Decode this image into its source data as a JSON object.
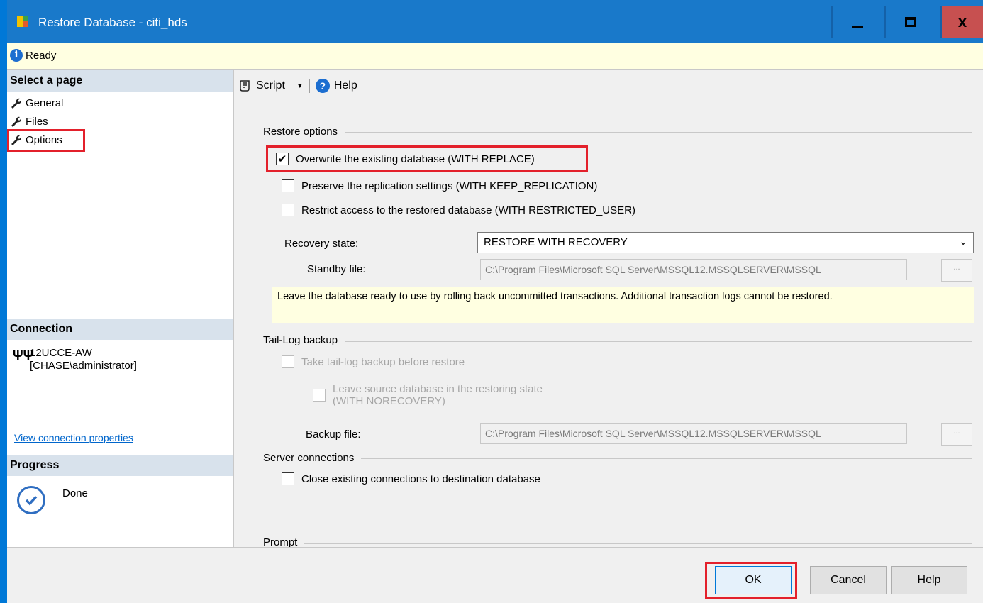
{
  "window": {
    "title": "Restore Database - citi_hds",
    "minimize_label": "minimize",
    "maximize_label": "maximize",
    "close_glyph": "x"
  },
  "status": {
    "text": "Ready",
    "icon": "info-icon"
  },
  "left": {
    "select_page_header": "Select a page",
    "pages": [
      {
        "label": "General",
        "icon": "wrench-icon"
      },
      {
        "label": "Files",
        "icon": "wrench-icon"
      },
      {
        "label": "Options",
        "icon": "wrench-icon",
        "highlighted": true
      }
    ],
    "connection_header": "Connection",
    "connection_server": "12UCCE-AW",
    "connection_user": "[CHASE\\administrator]",
    "view_connection_link": "View connection properties",
    "progress_header": "Progress",
    "progress_status": "Done"
  },
  "toolbar": {
    "script_label": "Script",
    "help_label": "Help"
  },
  "restore_options": {
    "group_label": "Restore options",
    "overwrite": {
      "label": "Overwrite the existing database (WITH REPLACE)",
      "checked": true
    },
    "preserve_replication": {
      "label": "Preserve the replication settings (WITH KEEP_REPLICATION)",
      "checked": false
    },
    "restrict_access": {
      "label": "Restrict access to the restored database (WITH RESTRICTED_USER)",
      "checked": false
    },
    "recovery_state_label": "Recovery state:",
    "recovery_state_value": "RESTORE WITH RECOVERY",
    "standby_file_label": "Standby file:",
    "standby_file_value": "C:\\Program Files\\Microsoft SQL Server\\MSSQL12.MSSQLSERVER\\MSSQL",
    "browse_label": "...",
    "recovery_note": "Leave the database ready to use by rolling back uncommitted transactions. Additional transaction logs cannot be restored."
  },
  "tail_log": {
    "group_label": "Tail-Log backup",
    "take_backup": {
      "label": "Take tail-log backup before restore",
      "checked": false,
      "enabled": false
    },
    "leave_source_line1": "Leave source database in the restoring state",
    "leave_source_line2": "(WITH NORECOVERY)",
    "backup_file_label": "Backup file:",
    "backup_file_value": "C:\\Program Files\\Microsoft SQL Server\\MSSQL12.MSSQLSERVER\\MSSQL",
    "browse_label": "..."
  },
  "server_connections": {
    "group_label": "Server connections",
    "close_existing": {
      "label": "Close existing connections to destination database",
      "checked": false
    }
  },
  "prompt": {
    "group_label": "Prompt"
  },
  "buttons": {
    "ok": "OK",
    "cancel": "Cancel",
    "help": "Help"
  },
  "colors": {
    "titlebar": "#1979ca",
    "highlight": "#e3202b",
    "status_bg": "#ffffe1",
    "close_bg": "#c75050"
  }
}
